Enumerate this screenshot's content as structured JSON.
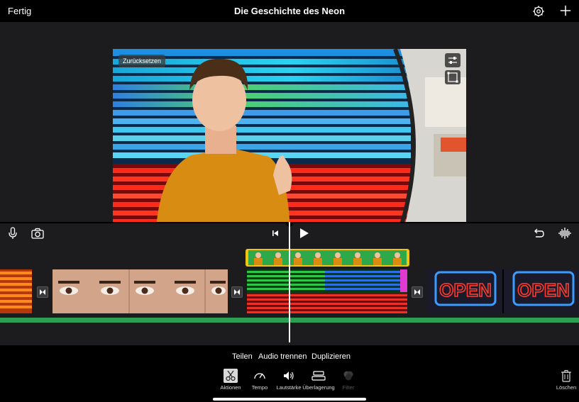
{
  "topbar": {
    "done_label": "Fertig",
    "title": "Die Geschichte des Neon",
    "settings_icon": "gear-icon",
    "add_icon": "plus-icon"
  },
  "viewer": {
    "reset_label": "Zurücksetzen",
    "overlay_settings_icon": "sliders-icon",
    "crop_icon": "crop-icon"
  },
  "toolbar": {
    "mic_icon": "microphone-icon",
    "camera_icon": "camera-icon",
    "skip_back_icon": "skip-to-start-icon",
    "play_icon": "play-icon",
    "undo_icon": "undo-icon",
    "waveform_icon": "waveform-icon"
  },
  "actions": {
    "share": "Teilen",
    "detach_audio": "Audio trennen",
    "duplicate": "Duplizieren"
  },
  "tools": [
    {
      "label": "Aktionen",
      "icon": "scissors-icon",
      "active": true
    },
    {
      "label": "Tempo",
      "icon": "speedometer-icon",
      "active": false
    },
    {
      "label": "Lautstärke",
      "icon": "speaker-icon",
      "active": false
    },
    {
      "label": "Überlagerung",
      "icon": "overlay-icon",
      "active": false
    },
    {
      "label": "Filter",
      "icon": "filter-icon",
      "active": false
    }
  ],
  "delete_label": "Löschen",
  "colors": {
    "accent_yellow": "#f2c30f",
    "audio_green": "#2d9f52",
    "background": "#1c1c1e"
  }
}
